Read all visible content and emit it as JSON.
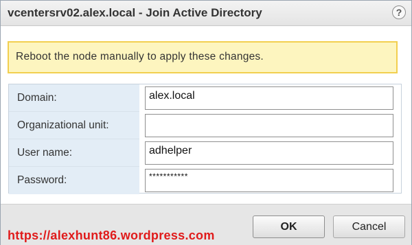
{
  "dialog": {
    "title": "vcentersrv02.alex.local - Join Active Directory",
    "help_label": "?"
  },
  "warning": {
    "message": "Reboot the node manually to apply these changes."
  },
  "form": {
    "fields": [
      {
        "label": "Domain:",
        "value": "alex.local",
        "type": "text"
      },
      {
        "label": "Organizational unit:",
        "value": "",
        "type": "text"
      },
      {
        "label": "User name:",
        "value": "adhelper",
        "type": "text"
      },
      {
        "label": "Password:",
        "value": "***********",
        "type": "password"
      }
    ]
  },
  "footer": {
    "watermark_url": "https://alexhunt86.wordpress.com",
    "ok_label": "OK",
    "cancel_label": "Cancel"
  },
  "colors": {
    "warning_background": "#fdf5bf",
    "warning_border": "#f2cf4f",
    "label_background": "#e3edf6",
    "watermark": "#e01b1b"
  },
  "icons": {
    "help": "help-icon"
  }
}
